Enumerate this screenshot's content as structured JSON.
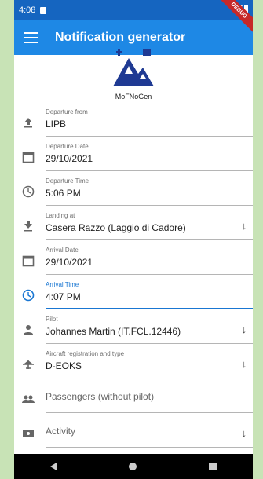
{
  "status": {
    "time": "4:08"
  },
  "appbar": {
    "title": "Notification generator"
  },
  "logo": {
    "text": "MoFNoGen"
  },
  "fields": {
    "departure_from": {
      "label": "Departure from",
      "value": "LIPB"
    },
    "departure_date": {
      "label": "Departure Date",
      "value": "29/10/2021"
    },
    "departure_time": {
      "label": "Departure Time",
      "value": "5:06 PM"
    },
    "landing_at": {
      "label": "Landing at",
      "value": "Casera Razzo (Laggio di Cadore)"
    },
    "arrival_date": {
      "label": "Arrival Date",
      "value": "29/10/2021"
    },
    "arrival_time": {
      "label": "Arrival Time",
      "value": "4:07 PM"
    },
    "pilot": {
      "label": "Pilot",
      "value": "Johannes Martin (IT.FCL.12446)"
    },
    "aircraft": {
      "label": "Aircraft registration and type",
      "value": "D-EOKS"
    },
    "passengers": {
      "placeholder": "Passengers (without pilot)"
    },
    "activity": {
      "placeholder": "Activity"
    }
  },
  "colors": {
    "primary": "#1e88e5",
    "status_bar": "#1565c0",
    "accent": "#1976d2",
    "logo": "#1f3a93"
  }
}
